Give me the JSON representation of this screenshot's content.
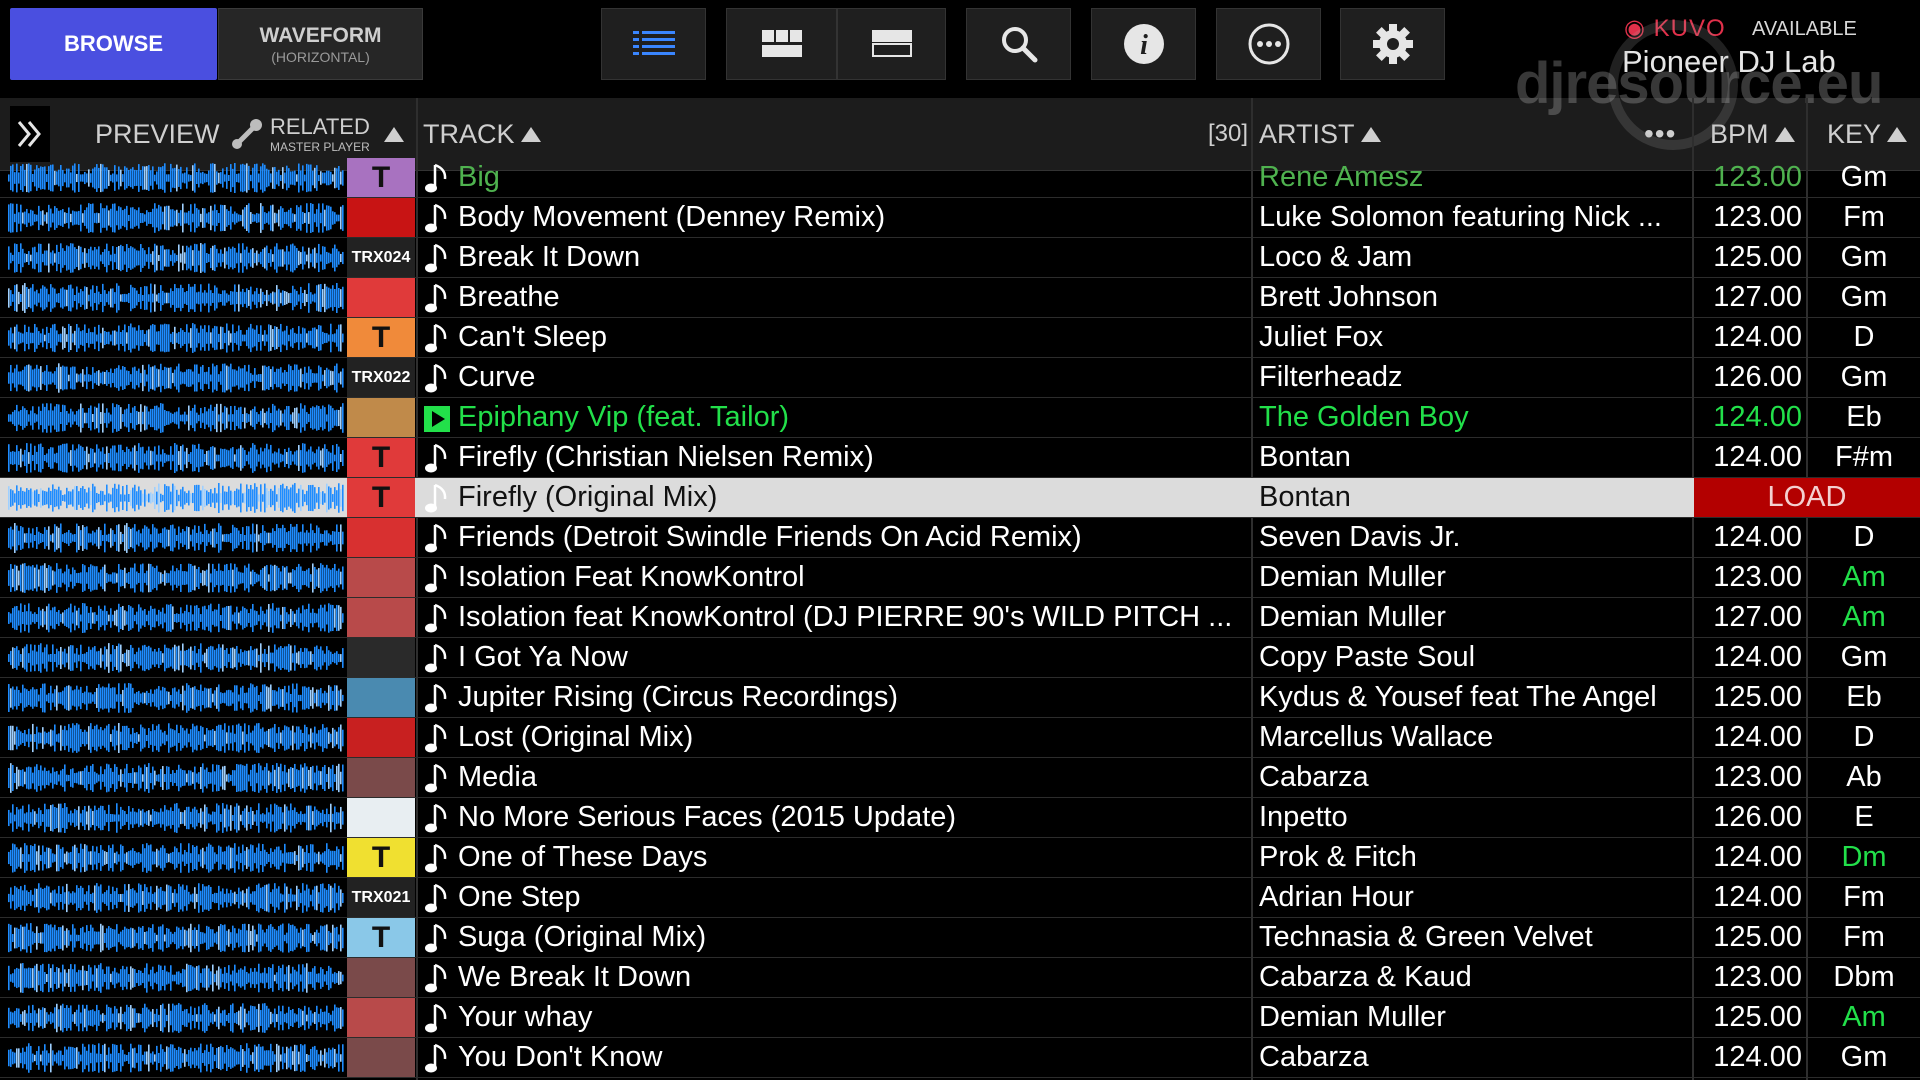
{
  "tabs": {
    "browse": "BROWSE",
    "waveform": "WAVEFORM",
    "waveform_sub": "(HORIZONTAL)"
  },
  "kuvo": {
    "logo": "KUVO",
    "status": "AVAILABLE",
    "name": "Pioneer DJ Lab"
  },
  "watermark": "djresource.eu",
  "icons": [
    "list-view-icon",
    "grid-view-icon",
    "split-view-icon",
    "search-icon",
    "info-icon",
    "more-icon",
    "gear-icon"
  ],
  "header": {
    "preview": "PREVIEW",
    "related": "RELATED",
    "related_sub": "MASTER PLAYER",
    "track": "TRACK",
    "count": "[30]",
    "artist": "ARTIST",
    "dots": "•••",
    "bpm": "BPM",
    "key": "KEY"
  },
  "load_label": "LOAD",
  "colors": {
    "browse_tab": "#4a4fe0",
    "waveform": "#1e8cff",
    "playing": "#22e04a",
    "load": "#b30000",
    "kuvo": "#e0304a"
  },
  "tracks": [
    {
      "title": "Big",
      "artist": "Rene Amesz",
      "bpm": "123.00",
      "key": "Gm",
      "art": "#a872c0",
      "art_text": "T",
      "state": "dim"
    },
    {
      "title": "Body Movement (Denney Remix)",
      "artist": "Luke Solomon featuring Nick ...",
      "bpm": "123.00",
      "key": "Fm",
      "art": "#c81414",
      "art_text": "",
      "state": ""
    },
    {
      "title": "Break It Down",
      "artist": "Loco & Jam",
      "bpm": "125.00",
      "key": "Gm",
      "art": "#222222",
      "art_text": "TRX024",
      "state": ""
    },
    {
      "title": "Breathe",
      "artist": "Brett Johnson",
      "bpm": "127.00",
      "key": "Gm",
      "art": "#e03a3a",
      "art_text": "",
      "state": ""
    },
    {
      "title": "Can't Sleep",
      "artist": "Juliet Fox",
      "bpm": "124.00",
      "key": "D",
      "art": "#f08a3a",
      "art_text": "T",
      "state": ""
    },
    {
      "title": "Curve",
      "artist": "Filterheadz",
      "bpm": "126.00",
      "key": "Gm",
      "art": "#222222",
      "art_text": "TRX022",
      "state": ""
    },
    {
      "title": "Epiphany Vip (feat. Tailor)",
      "artist": "The Golden Boy",
      "bpm": "124.00",
      "key": "Eb",
      "art": "#c08a4a",
      "art_text": "",
      "state": "playing"
    },
    {
      "title": "Firefly (Christian Nielsen Remix)",
      "artist": "Bontan",
      "bpm": "124.00",
      "key": "F#m",
      "art": "#e03a3a",
      "art_text": "T",
      "state": ""
    },
    {
      "title": "Firefly (Original Mix)",
      "artist": "Bontan",
      "bpm": "",
      "key": "",
      "art": "#e03a3a",
      "art_text": "T",
      "state": "selected"
    },
    {
      "title": "Friends (Detroit Swindle Friends On Acid Remix)",
      "artist": "Seven Davis Jr.",
      "bpm": "124.00",
      "key": "D",
      "art": "#d83030",
      "art_text": "",
      "state": ""
    },
    {
      "title": "Isolation Feat KnowKontrol",
      "artist": "Demian Muller",
      "bpm": "123.00",
      "key": "Am",
      "art": "#b84a4a",
      "art_text": "",
      "state": "",
      "key_green": true
    },
    {
      "title": "Isolation feat KnowKontrol (DJ PIERRE 90's WILD PITCH ...",
      "artist": "Demian Muller",
      "bpm": "127.00",
      "key": "Am",
      "art": "#b84a4a",
      "art_text": "",
      "state": "",
      "key_green": true
    },
    {
      "title": "I Got Ya Now",
      "artist": "Copy Paste Soul",
      "bpm": "124.00",
      "key": "Gm",
      "art": "#2a2a2a",
      "art_text": "",
      "state": ""
    },
    {
      "title": "Jupiter Rising (Circus Recordings)",
      "artist": "Kydus & Yousef feat The Angel",
      "bpm": "125.00",
      "key": "Eb",
      "art": "#4a8ab0",
      "art_text": "",
      "state": ""
    },
    {
      "title": "Lost (Original Mix)",
      "artist": "Marcellus Wallace",
      "bpm": "124.00",
      "key": "D",
      "art": "#c82020",
      "art_text": "",
      "state": ""
    },
    {
      "title": "Media",
      "artist": "Cabarza",
      "bpm": "123.00",
      "key": "Ab",
      "art": "#7a4a4a",
      "art_text": "",
      "state": ""
    },
    {
      "title": "No More Serious Faces (2015 Update)",
      "artist": "Inpetto",
      "bpm": "126.00",
      "key": "E",
      "art": "#e8eef2",
      "art_text": "",
      "state": ""
    },
    {
      "title": "One of These Days",
      "artist": "Prok & Fitch",
      "bpm": "124.00",
      "key": "Dm",
      "art": "#f0e030",
      "art_text": "T",
      "state": "",
      "key_green": true
    },
    {
      "title": "One Step",
      "artist": "Adrian Hour",
      "bpm": "124.00",
      "key": "Fm",
      "art": "#222222",
      "art_text": "TRX021",
      "state": ""
    },
    {
      "title": "Suga (Original Mix)",
      "artist": "Technasia & Green Velvet",
      "bpm": "125.00",
      "key": "Fm",
      "art": "#8ac8e8",
      "art_text": "T",
      "state": ""
    },
    {
      "title": "We Break It Down",
      "artist": "Cabarza & Kaud",
      "bpm": "123.00",
      "key": "Dbm",
      "art": "#7a4a4a",
      "art_text": "",
      "state": ""
    },
    {
      "title": "Your whay",
      "artist": "Demian Muller",
      "bpm": "125.00",
      "key": "Am",
      "art": "#b84a4a",
      "art_text": "",
      "state": "",
      "key_green": true
    },
    {
      "title": "You Don't Know",
      "artist": "Cabarza",
      "bpm": "124.00",
      "key": "Gm",
      "art": "#7a4a4a",
      "art_text": "",
      "state": ""
    }
  ]
}
